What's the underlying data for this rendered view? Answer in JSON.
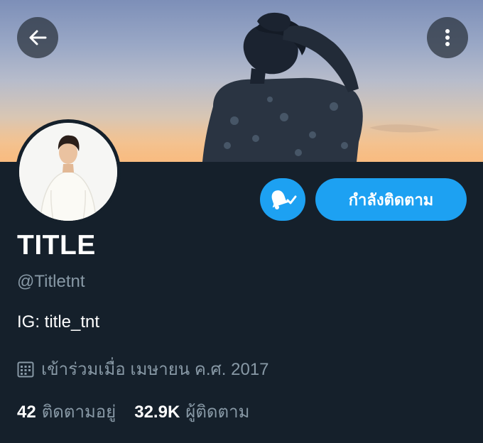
{
  "header": {
    "back_icon": "arrow-left-icon",
    "more_icon": "more-vertical-icon"
  },
  "profile": {
    "display_name": "TITLE",
    "handle": "@Titletnt",
    "bio": "IG: title_tnt",
    "joined": "เข้าร่วมเมื่อ เมษายน ค.ศ. 2017",
    "joined_icon": "calendar-icon"
  },
  "actions": {
    "notify_icon": "bell-check-icon",
    "follow_label": "กำลังติดตาม"
  },
  "stats": {
    "following_count": "42",
    "following_label": "ติดตามอยู่",
    "followers_count": "32.9K",
    "followers_label": "ผู้ติดตาม"
  },
  "colors": {
    "background": "#15202b",
    "accent": "#1da1f2",
    "muted_text": "#8899a6"
  }
}
